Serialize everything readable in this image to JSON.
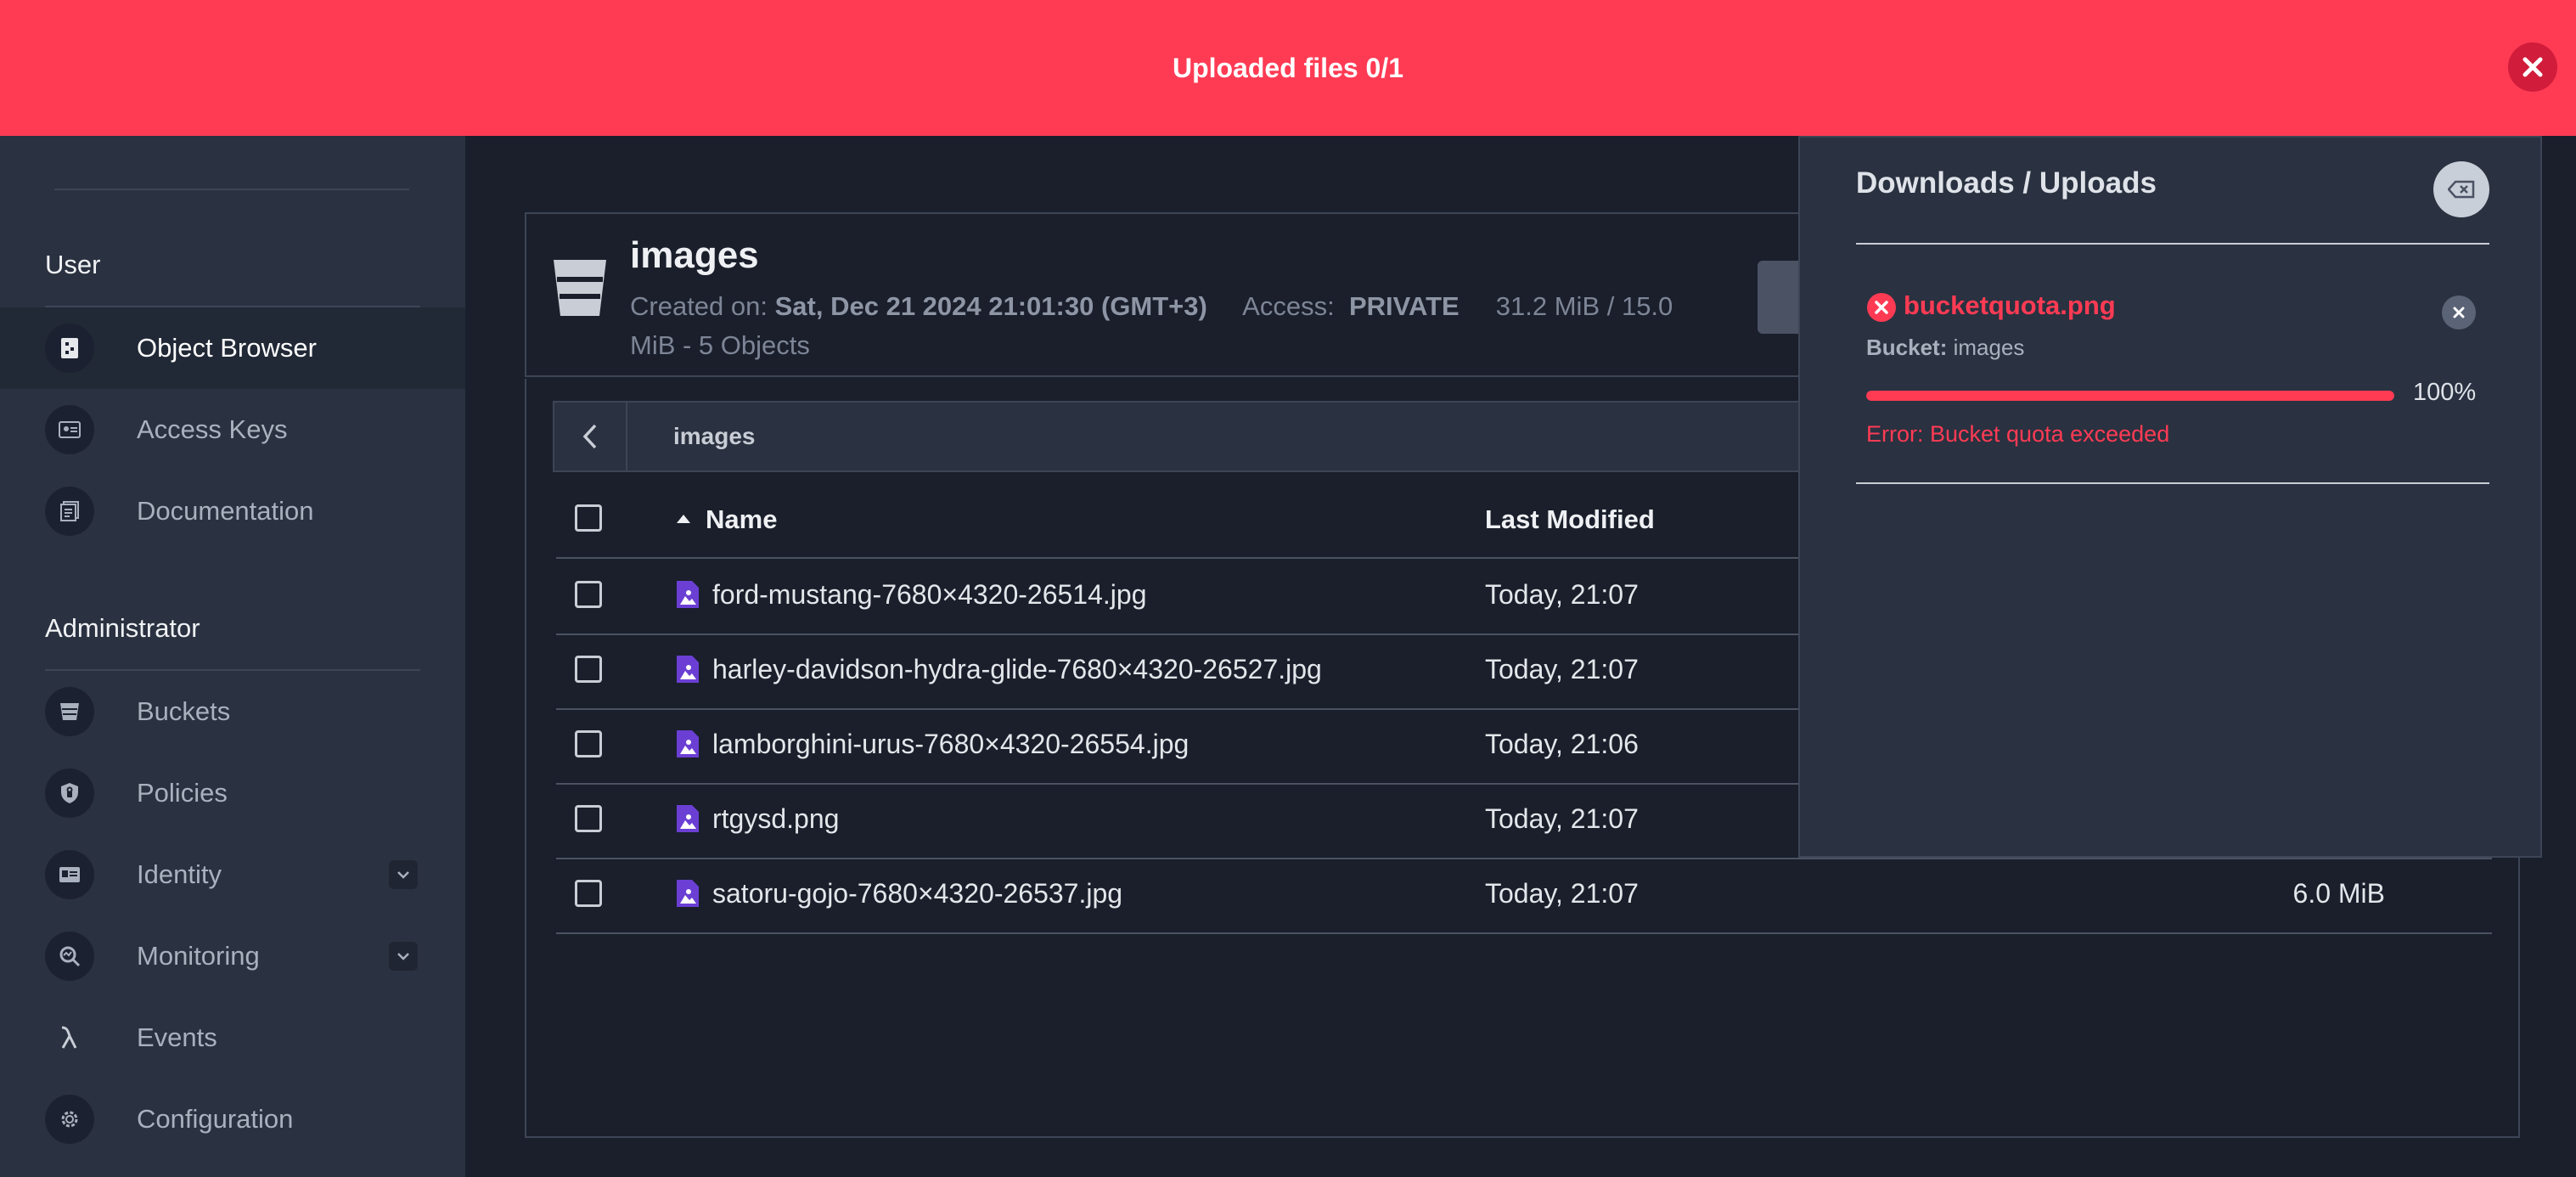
{
  "banner": {
    "text": "Uploaded files 0/1"
  },
  "sidebar": {
    "user_section": "User",
    "admin_section": "Administrator",
    "user_items": [
      {
        "label": "Object Browser",
        "icon": "object-browser-icon",
        "active": true
      },
      {
        "label": "Access Keys",
        "icon": "access-keys-icon"
      },
      {
        "label": "Documentation",
        "icon": "documentation-icon"
      }
    ],
    "admin_items": [
      {
        "label": "Buckets",
        "icon": "bucket-icon"
      },
      {
        "label": "Policies",
        "icon": "shield-icon"
      },
      {
        "label": "Identity",
        "icon": "id-card-icon",
        "expandable": true
      },
      {
        "label": "Monitoring",
        "icon": "monitoring-icon",
        "expandable": true
      },
      {
        "label": "Events",
        "icon": "lambda-icon"
      },
      {
        "label": "Configuration",
        "icon": "gear-icon"
      }
    ]
  },
  "bucket": {
    "name": "images",
    "created_label": "Created on:",
    "created_value": "Sat, Dec 21 2024 21:01:30 (GMT+3)",
    "access_label": "Access:",
    "access_value": "PRIVATE",
    "usage": "31.2 MiB / 15.0",
    "usage_line2": "MiB - 5 Objects"
  },
  "breadcrumb": {
    "path": "images"
  },
  "table": {
    "columns": [
      "Name",
      "Last Modified"
    ],
    "rows": [
      {
        "name": "ford-mustang-7680×4320-26514.jpg",
        "modified": "Today, 21:07",
        "size": ""
      },
      {
        "name": "harley-davidson-hydra-glide-7680×4320-26527.jpg",
        "modified": "Today, 21:07",
        "size": ""
      },
      {
        "name": "lamborghini-urus-7680×4320-26554.jpg",
        "modified": "Today, 21:06",
        "size": ""
      },
      {
        "name": "rtgysd.png",
        "modified": "Today, 21:07",
        "size": ""
      },
      {
        "name": "satoru-gojo-7680×4320-26537.jpg",
        "modified": "Today, 21:07",
        "size": "6.0 MiB"
      }
    ]
  },
  "downloads": {
    "title": "Downloads / Uploads",
    "item": {
      "file": "bucketquota.png",
      "bucket_label": "Bucket:",
      "bucket_value": "images",
      "progress_percent": 100,
      "progress_label": "100%",
      "error": "Error: Bucket quota exceeded"
    }
  },
  "colors": {
    "accent_error": "#ff3b54",
    "sidebar_bg": "#2a3140",
    "main_bg": "#1a1f2b"
  }
}
